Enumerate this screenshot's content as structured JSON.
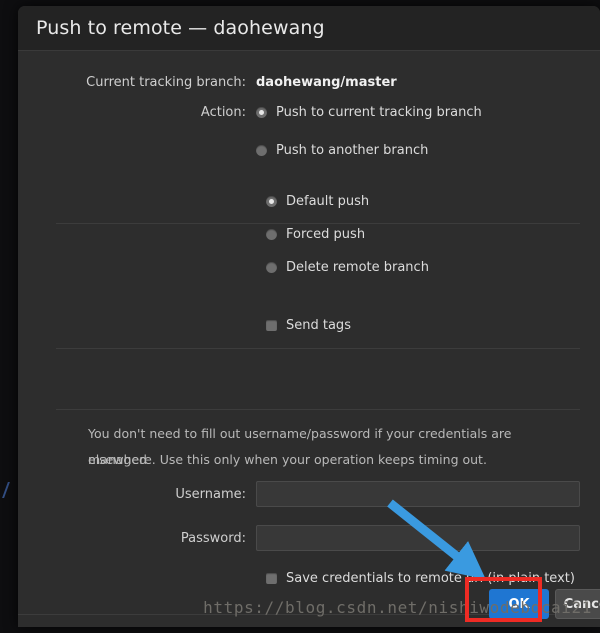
{
  "dialog": {
    "title": "Push to remote — daohewang"
  },
  "tracking": {
    "label": "Current tracking branch:",
    "value": "daohewang/master"
  },
  "action": {
    "label": "Action:",
    "options": [
      {
        "label": "Push to current tracking branch",
        "selected": true
      },
      {
        "label": "Push to another branch",
        "selected": false
      }
    ]
  },
  "push_mode": {
    "options": [
      {
        "label": "Default push",
        "selected": true
      },
      {
        "label": "Forced push",
        "selected": false
      },
      {
        "label": "Delete remote branch",
        "selected": false
      }
    ]
  },
  "tags": {
    "send_tags_label": "Send tags",
    "send_tags_checked": false
  },
  "credentials": {
    "help_line_1": "You don't need to fill out username/password if your credentials are managed",
    "help_line_2": "elsewhere. Use this only when your operation keeps timing out.",
    "username_label": "Username:",
    "username_value": "",
    "username_placeholder": "",
    "password_label": "Password:",
    "password_value": "",
    "password_placeholder": "",
    "save_credentials_label": "Save credentials to remote url (in plain text)",
    "save_credentials_checked": false
  },
  "footer": {
    "ok_label": "OK",
    "cancel_label": "Cancel"
  },
  "annotations": {
    "arrow_color": "#3a9ae0",
    "highlight_color": "#ee2b24",
    "arrow_name": "blue-arrow-pointing-to-ok-button"
  },
  "watermark": {
    "text": "https://blog.csdn.net/nishiwodebocai21"
  },
  "colors": {
    "accent": "#1f76d2",
    "dialog_background": "#2d2d2d",
    "titlebar_background": "#232323"
  }
}
